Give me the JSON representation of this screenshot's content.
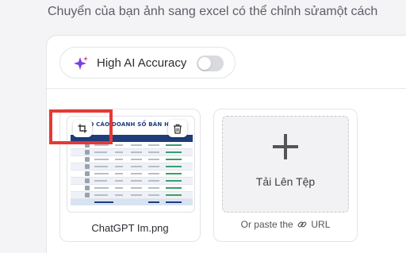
{
  "instruction": "Chuyển của bạn ảnh sang excel có thể chỉnh sửamột cách",
  "accuracy": {
    "label": "High AI Accuracy",
    "enabled": false
  },
  "file": {
    "name": "ChatGPT Im.png",
    "preview_title": "BÁO CÁO DOANH SỐ BÁN HÀNG"
  },
  "upload": {
    "label": "Tải Lên Tệp",
    "paste_prefix": "Or paste the",
    "paste_suffix": "URL"
  },
  "colors": {
    "accent_highlight": "#e53935",
    "sheet_header": "#1f3d7a",
    "sparkle": "#7b3fe4"
  }
}
